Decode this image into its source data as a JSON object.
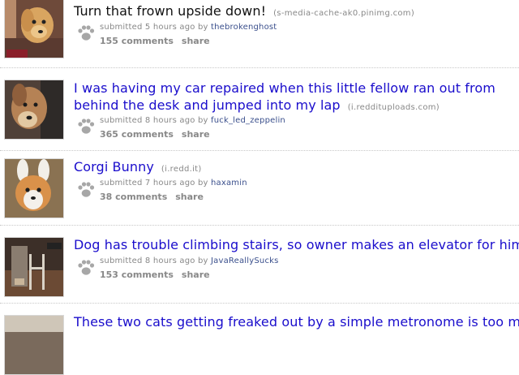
{
  "colors": {
    "title_black": "#111111",
    "title_link": "#1a0dcc",
    "meta_gray": "#888888",
    "author_blue": "#3a4f8c",
    "divider": "#c8c8c8"
  },
  "icons": {
    "paw": "paw-print-icon"
  },
  "posts": [
    {
      "title": "Turn that frown upside down!",
      "domain": "(s-media-cache-ak0.pinimg.com)",
      "submitted": "submitted 5 hours ago by",
      "author": "thebrokenghost",
      "comments": "155 comments",
      "share": "share"
    },
    {
      "title": "I was having my car repaired when this little fellow ran out from behind the desk and jumped into my lap",
      "domain": "(i.reddituploads.com)",
      "submitted": "submitted 8 hours ago by",
      "author": "fuck_led_zeppelin",
      "comments": "365 comments",
      "share": "share"
    },
    {
      "title": "Corgi Bunny",
      "domain": "(i.redd.it)",
      "submitted": "submitted 7 hours ago by",
      "author": "haxamin",
      "comments": "38 comments",
      "share": "share"
    },
    {
      "title": "Dog has trouble climbing stairs, so owner makes an elevator for him",
      "domain": "",
      "submitted": "submitted 8 hours ago by",
      "author": "JavaReallySucks",
      "comments": "153 comments",
      "share": "share"
    },
    {
      "title": "These two cats getting freaked out by a simple metronome is too much",
      "domain": "",
      "submitted": "",
      "author": "",
      "comments": "",
      "share": ""
    }
  ]
}
